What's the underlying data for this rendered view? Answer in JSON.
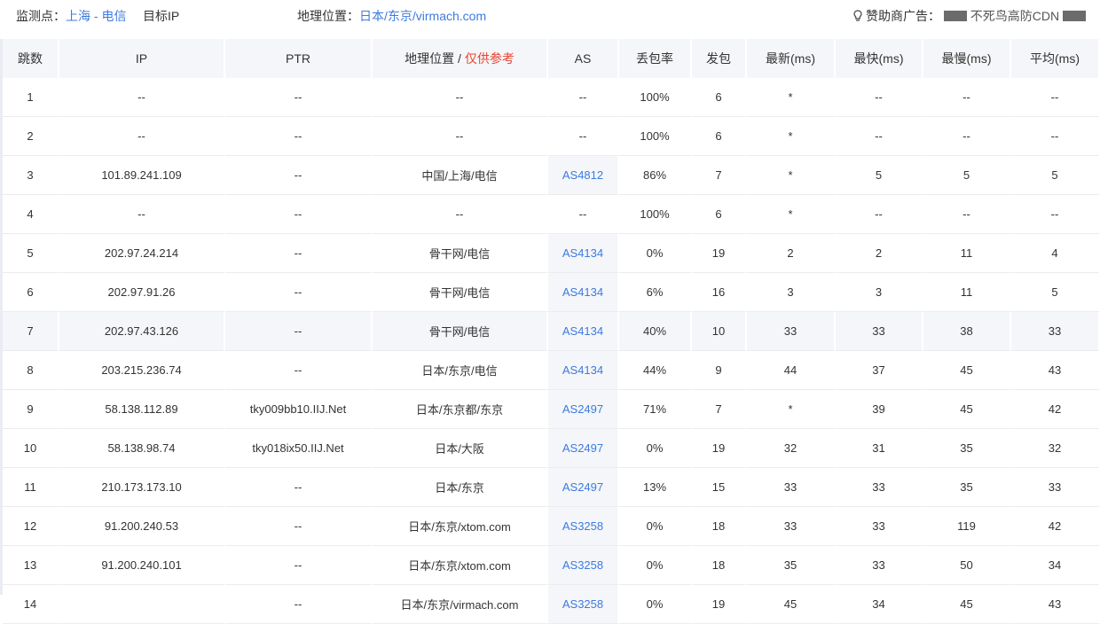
{
  "header": {
    "monitor_label": "监测点：",
    "monitor_value": "上海 - 电信",
    "target_label": "目标IP",
    "geo_label": "地理位置：",
    "geo_value": "日本/东京/virmach.com",
    "sponsor_label": "赞助商广告：",
    "sponsor_text": "不死鸟高防CDN",
    "sponsor_icon": "lightbulb-icon"
  },
  "table": {
    "columns": [
      "跳数",
      "IP",
      "PTR",
      "地理位置",
      "AS",
      "丢包率",
      "发包",
      "最新(ms)",
      "最快(ms)",
      "最慢(ms)",
      "平均(ms)"
    ],
    "geo_sep": " / ",
    "geo_note": "仅供参考",
    "rows": [
      {
        "hop": "1",
        "ip": "--",
        "ptr": "--",
        "geo": "--",
        "as": "--",
        "loss": "100%",
        "sent": "6",
        "last": "*",
        "best": "--",
        "worst": "--",
        "avg": "--"
      },
      {
        "hop": "2",
        "ip": "--",
        "ptr": "--",
        "geo": "--",
        "as": "--",
        "loss": "100%",
        "sent": "6",
        "last": "*",
        "best": "--",
        "worst": "--",
        "avg": "--"
      },
      {
        "hop": "3",
        "ip": "101.89.241.109",
        "ptr": "--",
        "geo": "中国/上海/电信",
        "as": "AS4812",
        "loss": "86%",
        "sent": "7",
        "last": "*",
        "best": "5",
        "worst": "5",
        "avg": "5"
      },
      {
        "hop": "4",
        "ip": "--",
        "ptr": "--",
        "geo": "--",
        "as": "--",
        "loss": "100%",
        "sent": "6",
        "last": "*",
        "best": "--",
        "worst": "--",
        "avg": "--"
      },
      {
        "hop": "5",
        "ip": "202.97.24.214",
        "ptr": "--",
        "geo": "骨干网/电信",
        "as": "AS4134",
        "loss": "0%",
        "sent": "19",
        "last": "2",
        "best": "2",
        "worst": "11",
        "avg": "4"
      },
      {
        "hop": "6",
        "ip": "202.97.91.26",
        "ptr": "--",
        "geo": "骨干网/电信",
        "as": "AS4134",
        "loss": "6%",
        "sent": "16",
        "last": "3",
        "best": "3",
        "worst": "11",
        "avg": "5"
      },
      {
        "hop": "7",
        "ip": "202.97.43.126",
        "ptr": "--",
        "geo": "骨干网/电信",
        "as": "AS4134",
        "loss": "40%",
        "sent": "10",
        "last": "33",
        "best": "33",
        "worst": "38",
        "avg": "33"
      },
      {
        "hop": "8",
        "ip": "203.215.236.74",
        "ptr": "--",
        "geo": "日本/东京/电信",
        "as": "AS4134",
        "loss": "44%",
        "sent": "9",
        "last": "44",
        "best": "37",
        "worst": "45",
        "avg": "43"
      },
      {
        "hop": "9",
        "ip": "58.138.112.89",
        "ptr": "tky009bb10.IIJ.Net",
        "geo": "日本/东京都/东京",
        "as": "AS2497",
        "loss": "71%",
        "sent": "7",
        "last": "*",
        "best": "39",
        "worst": "45",
        "avg": "42"
      },
      {
        "hop": "10",
        "ip": "58.138.98.74",
        "ptr": "tky018ix50.IIJ.Net",
        "geo": "日本/大阪",
        "as": "AS2497",
        "loss": "0%",
        "sent": "19",
        "last": "32",
        "best": "31",
        "worst": "35",
        "avg": "32"
      },
      {
        "hop": "11",
        "ip": "210.173.173.10",
        "ptr": "--",
        "geo": "日本/东京",
        "as": "AS2497",
        "loss": "13%",
        "sent": "15",
        "last": "33",
        "best": "33",
        "worst": "35",
        "avg": "33"
      },
      {
        "hop": "12",
        "ip": "91.200.240.53",
        "ptr": "--",
        "geo": "日本/东京/xtom.com",
        "as": "AS3258",
        "loss": "0%",
        "sent": "18",
        "last": "33",
        "best": "33",
        "worst": "119",
        "avg": "42"
      },
      {
        "hop": "13",
        "ip": "91.200.240.101",
        "ptr": "--",
        "geo": "日本/东京/xtom.com",
        "as": "AS3258",
        "loss": "0%",
        "sent": "18",
        "last": "35",
        "best": "33",
        "worst": "50",
        "avg": "34"
      },
      {
        "hop": "14",
        "ip": "",
        "ptr": "--",
        "geo": "日本/东京/virmach.com",
        "as": "AS3258",
        "loss": "0%",
        "sent": "19",
        "last": "45",
        "best": "34",
        "worst": "45",
        "avg": "43"
      }
    ]
  },
  "colors": {
    "link": "#3c7be0",
    "note": "#e8442f",
    "header_bg": "#f5f6f9"
  }
}
